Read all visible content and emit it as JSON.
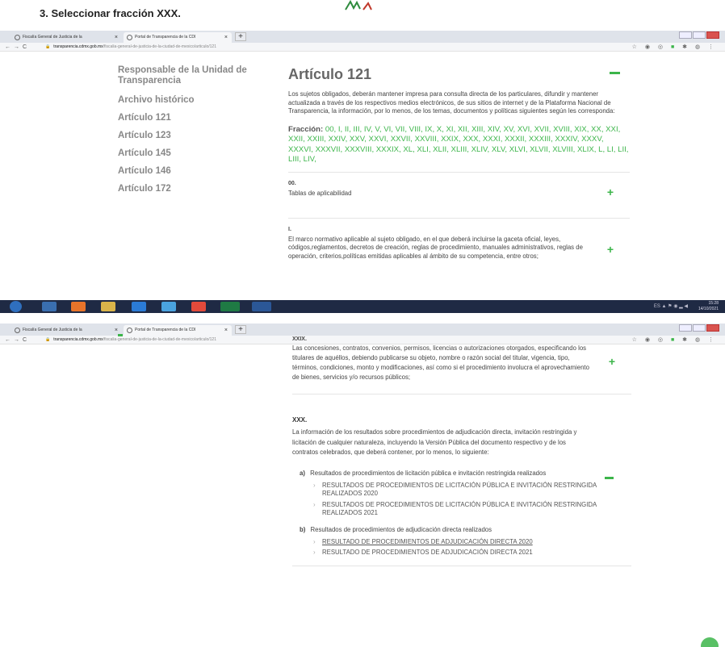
{
  "step": {
    "title": "3.  Seleccionar fracción XXX."
  },
  "browser": {
    "tabs": [
      "Fiscalía General de Justicia de la",
      "Portal de Transparencia de la CDI"
    ],
    "url_host": "transparencia.cdmx.gob.mx",
    "url_path": "/fiscalia-general-de-justicia-de-la-ciudad-de-mexico/articulo/121"
  },
  "sidebar": {
    "items": [
      "Responsable de la Unidad de Transparencia",
      "Archivo histórico",
      "Artículo 121",
      "Artículo 123",
      "Artículo 145",
      "Artículo 146",
      "Artículo 172"
    ]
  },
  "main": {
    "title": "Artículo 121",
    "intro": "Los sujetos obligados, deberán mantener impresa para consulta directa de los particulares, difundir y mantener actualizada a través de los respectivos medios electrónicos, de sus sitios de internet y de la Plataforma Nacional de Transparencia, la información, por lo menos, de los temas, documentos y políticas siguientes según les corresponda:",
    "fraccion_label": "Fracción:",
    "fraccion_list": "00, I, II, III, IV, V, VI, VII, VIII, IX, X, XI, XII, XIII, XIV, XV, XVI, XVII, XVIII, XIX, XX, XXI, XXII, XXIII, XXIV, XXV, XXVI, XXVII, XXVIII, XXIX, XXX, XXXI, XXXII, XXXIII, XXXIV, XXXV, XXXVI, XXXVII, XXXVIII, XXXIX, XL, XLI, XLII, XLIII, XLIV, XLV, XLVI, XLVII, XLVIII, XLIX, L, LI, LII, LIII, LIV,",
    "item_00_num": "00.",
    "item_00_text": "Tablas de aplicabilidad",
    "item_i_num": "I.",
    "item_i_text": "El marco normativo aplicable al sujeto obligado, en el que deberá incluirse la gaceta oficial, leyes, códigos,reglamentos, decretos de creación, reglas de procedimiento, manuales administrativos, reglas de operación, criterios,políticas emitidas aplicables al ámbito de su competencia, entre otros;"
  },
  "taskbar": {
    "lang": "ES",
    "time": "15:28",
    "date": "14/10/2021"
  },
  "main2": {
    "xxix_head": "XXIX.",
    "xxix_text": "Las concesiones, contratos, convenios, permisos, licencias o autorizaciones otorgados, especificando los titulares de aquéllos, debiendo publicarse su objeto, nombre o razón social del titular, vigencia, tipo, términos, condiciones, monto y modificaciones, así como si el procedimiento involucra el aprovechamiento de bienes, servicios y/o recursos públicos;",
    "xxx_head": "XXX.",
    "xxx_text": "La información de los resultados sobre procedimientos de adjudicación directa, invitación restringida y licitación de cualquier naturaleza, incluyendo la Versión Pública del documento respectivo y de los contratos celebrados, que deberá contener, por lo menos, lo siguiente:",
    "sub_a_label": "a)",
    "sub_a_text": "Resultados de procedimientos de licitación pública e invitación restringida realizados",
    "sub_a_links": [
      "RESULTADOS DE PROCEDIMIENTOS DE LICITACIÓN PÚBLICA E INVITACIÓN RESTRINGIDA REALIZADOS 2020",
      "RESULTADOS DE PROCEDIMIENTOS DE LICITACIÓN PÚBLICA E INVITACIÓN RESTRINGIDA REALIZADOS 2021"
    ],
    "sub_b_label": "b)",
    "sub_b_text": "Resultados de procedimientos de adjudicación directa realizados",
    "sub_b_links": [
      "RESULTADO DE PROCEDIMIENTOS DE ADJUDICACIÓN DIRECTA 2020",
      "RESULTADO DE PROCEDIMIENTOS DE ADJUDICACIÓN DIRECTA 2021"
    ]
  },
  "colors": {
    "accent": "#3cb54a",
    "taskbar": "#1f2a44"
  }
}
